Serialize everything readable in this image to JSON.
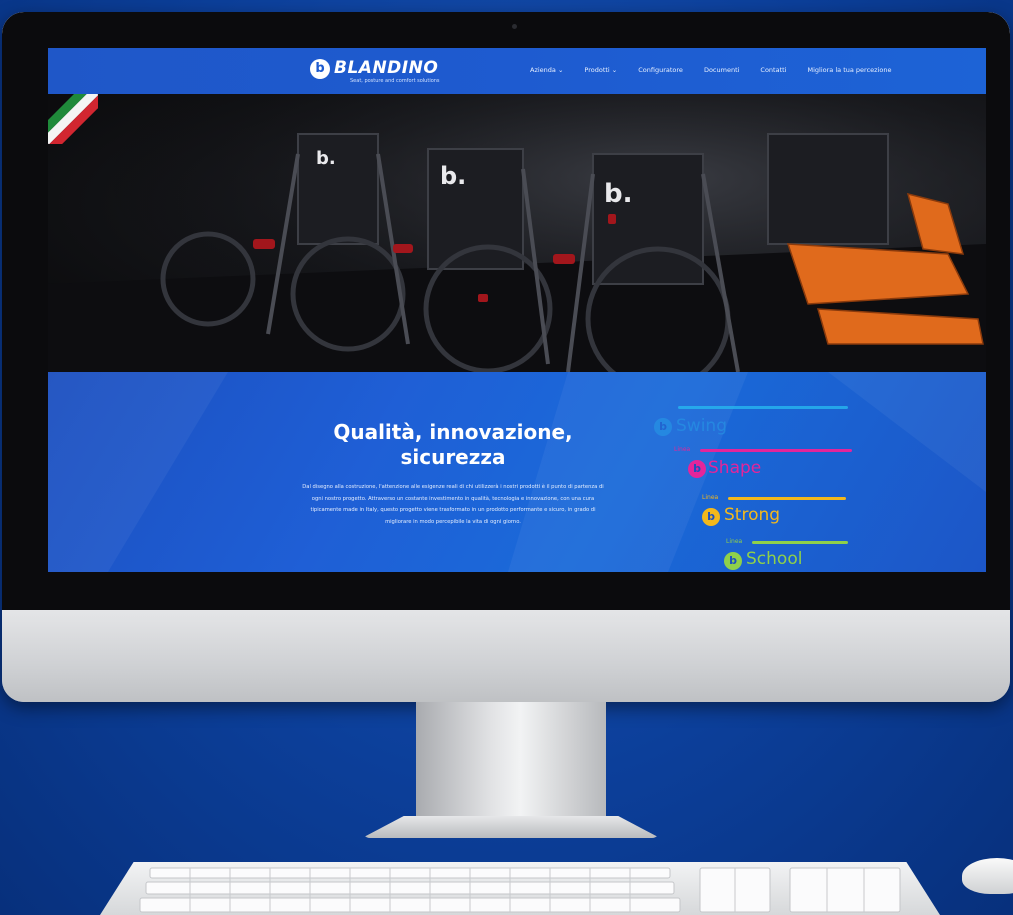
{
  "site": {
    "logo_mark": "b",
    "logo_text": "BLANDINO",
    "logo_tagline": "Seat, posture and comfort solutions",
    "nav": [
      {
        "label": "Azienda ⌄",
        "icon": "chevron-down-icon"
      },
      {
        "label": "Prodotti ⌄",
        "icon": "chevron-down-icon"
      },
      {
        "label": "Configuratore"
      },
      {
        "label": "Documenti"
      },
      {
        "label": "Contatti"
      },
      {
        "label": "Migliora la tua percezione"
      }
    ]
  },
  "hero": {
    "badge_icon": "italian-flag-icon",
    "product_marks": [
      "b.",
      "b.",
      "b."
    ]
  },
  "band": {
    "title_line1": "Qualità, innovazione,",
    "title_line2": "sicurezza",
    "body": "Dal disegno alla costruzione, l'attenzione alle esigenze reali di chi utilizzerà i nostri prodotti è il punto di partenza di ogni nostro progetto. Attraverso un costante investimento in qualità, tecnologia e innovazione, con una cura tipicamente made in Italy, questo progetto viene trasformato in un prodotto performante e sicuro, in grado di migliorare in modo percepibile la vita di ogni giorno."
  },
  "product_lines": [
    {
      "prefix": "",
      "name": "Swing",
      "mark": "b",
      "color": "#27b7ef"
    },
    {
      "prefix": "Linea",
      "name": "Shape",
      "mark": "b",
      "color": "#e4259a"
    },
    {
      "prefix": "Linea",
      "name": "Strong",
      "mark": "b",
      "color": "#f3b81c"
    },
    {
      "prefix": "Linea",
      "name": "School",
      "mark": "b",
      "color": "#8fd04a"
    }
  ],
  "colors": {
    "background": "#0c3f9a",
    "nav": "#1e5bd0",
    "accent_orange": "#e06a1c"
  }
}
